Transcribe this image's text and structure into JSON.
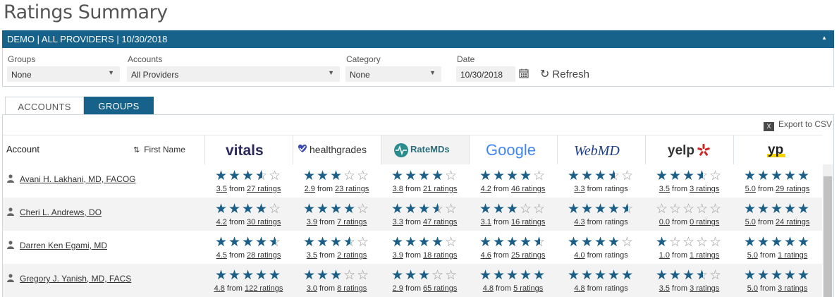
{
  "page": {
    "title": "Ratings Summary"
  },
  "panel": {
    "header": "DEMO | ALL PROVIDERS | 10/30/2018"
  },
  "filters": {
    "groups_label": "Groups",
    "groups_value": "None",
    "accounts_label": "Accounts",
    "accounts_value": "All Providers",
    "category_label": "Category",
    "category_value": "None",
    "date_label": "Date",
    "date_value": "10/30/2018",
    "refresh_label": "Refresh"
  },
  "tabs": [
    {
      "label": "ACCOUNTS"
    },
    {
      "label": "GROUPS"
    }
  ],
  "export_label": "Export to CSV",
  "table": {
    "account_header": "Account",
    "first_name_header": "First Name",
    "sites": [
      "vitals",
      "healthgrades",
      "RateMDs",
      "Google",
      "WebMD",
      "yelp",
      "yp"
    ],
    "rows": [
      {
        "name": "Avani H. Lakhani, MD, FACOG",
        "ratings": [
          {
            "score": "3.5",
            "text": "from",
            "count": "27 ratings"
          },
          {
            "score": "2.9",
            "text": "from",
            "count": "23 ratings"
          },
          {
            "score": "3.8",
            "text": "from",
            "count": "21 ratings"
          },
          {
            "score": "4.2",
            "text": "from",
            "count": "46 ratings"
          },
          {
            "score": "3.3",
            "text": "from ratings",
            "count": ""
          },
          {
            "score": "3.5",
            "text": "from",
            "count": "3 ratings"
          },
          {
            "score": "5.0",
            "text": "from",
            "count": "29 ratings"
          }
        ]
      },
      {
        "name": "Cheri L. Andrews, DO",
        "ratings": [
          {
            "score": "4.2",
            "text": "from",
            "count": "30 ratings"
          },
          {
            "score": "3.9",
            "text": "from",
            "count": "7 ratings"
          },
          {
            "score": "3.3",
            "text": "from",
            "count": "47 ratings"
          },
          {
            "score": "3.1",
            "text": "from",
            "count": "16 ratings"
          },
          {
            "score": "4.3",
            "text": "from ratings",
            "count": ""
          },
          {
            "score": "0.0",
            "text": "from",
            "count": "0 ratings"
          },
          {
            "score": "5.0",
            "text": "from",
            "count": "24 ratings"
          }
        ]
      },
      {
        "name": "Darren Ken Egami, MD",
        "ratings": [
          {
            "score": "4.5",
            "text": "from",
            "count": "28 ratings"
          },
          {
            "score": "3.5",
            "text": "from",
            "count": "2 ratings"
          },
          {
            "score": "3.9",
            "text": "from",
            "count": "18 ratings"
          },
          {
            "score": "4.6",
            "text": "from",
            "count": "25 ratings"
          },
          {
            "score": "4.0",
            "text": "from ratings",
            "count": ""
          },
          {
            "score": "1.0",
            "text": "from",
            "count": "1 ratings"
          },
          {
            "score": "5.0",
            "text": "from",
            "count": "1 ratings"
          }
        ]
      },
      {
        "name": "Gregory J. Yanish, MD, FACS",
        "ratings": [
          {
            "score": "4.8",
            "text": "from",
            "count": "122 ratings"
          },
          {
            "score": "3.0",
            "text": "from",
            "count": "8 ratings"
          },
          {
            "score": "2.9",
            "text": "from",
            "count": "65 ratings"
          },
          {
            "score": "4.8",
            "text": "from",
            "count": "5 ratings"
          },
          {
            "score": "4.8",
            "text": "from ratings",
            "count": ""
          },
          {
            "score": "3.5",
            "text": "from",
            "count": "3 ratings"
          },
          {
            "score": "5.0",
            "text": "from",
            "count": "3 ratings"
          }
        ]
      }
    ]
  },
  "colors": {
    "accent": "#17628a",
    "star": "#1b5e86",
    "star_empty": "#999999"
  }
}
